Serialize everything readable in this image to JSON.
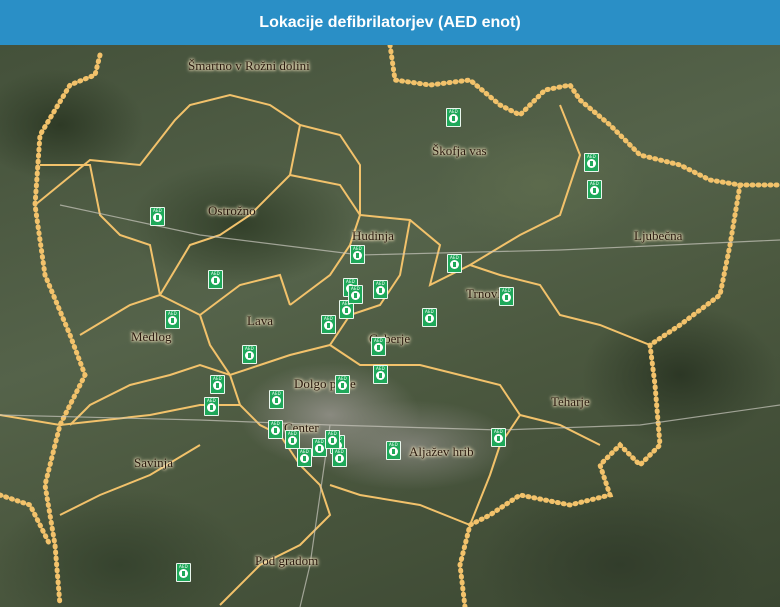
{
  "header": {
    "title": "Lokacije defibrilatorjev (AED enot)"
  },
  "colors": {
    "header_bg": "#2a8fc6",
    "boundary": "#f2c26b",
    "aed_marker": "#1fa85a"
  },
  "map": {
    "regions": [
      "Šmartno v Rožni dolini",
      "Škofja vas",
      "Ostrožno",
      "Hudinja",
      "Ljubečna",
      "Trnovlje",
      "Lava",
      "Medlog",
      "Gaberje",
      "Dolgo polje",
      "Teharje",
      "Savinja",
      "Aljažev hrib",
      "Center",
      "Pod gradom"
    ],
    "aed_marker_icon": "aed-defibrillator-icon",
    "aed_marker_text": "AED",
    "aed_marker_count": 36
  }
}
